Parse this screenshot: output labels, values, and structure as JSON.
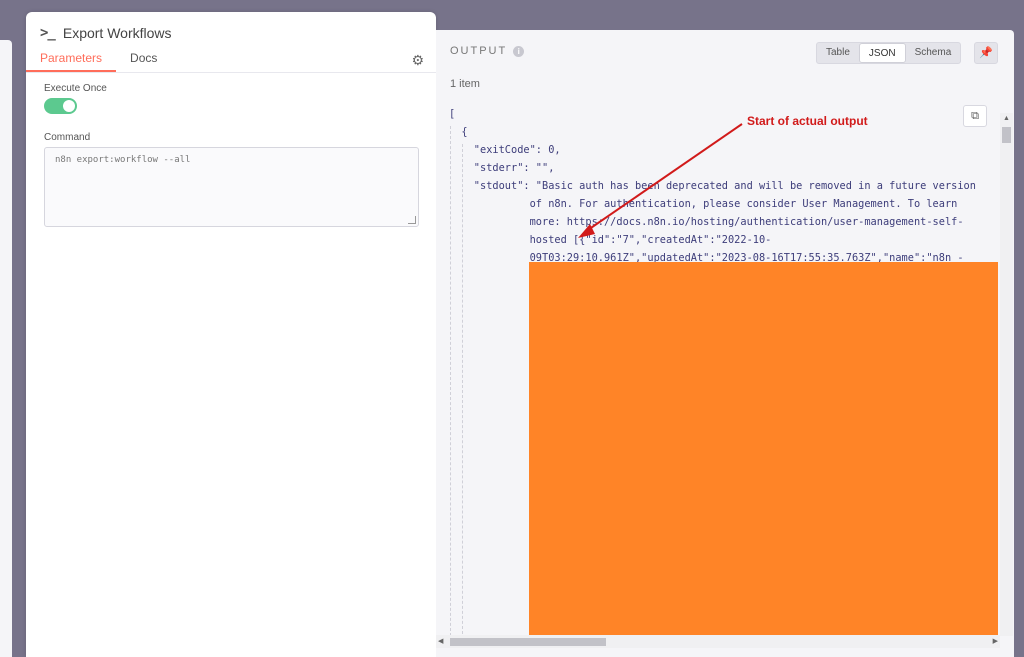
{
  "node": {
    "icon": ">_",
    "title": "Export Workflows",
    "tabs": [
      "Parameters",
      "Docs"
    ],
    "active_tab": "Parameters"
  },
  "params": {
    "execute_once_label": "Execute Once",
    "execute_once_value": true,
    "command_label": "Command",
    "command_value": "n8n export:workflow --all"
  },
  "output": {
    "title": "OUTPUT",
    "item_count": "1 item",
    "views": [
      "Table",
      "JSON",
      "Schema"
    ],
    "active_view": "JSON",
    "json_lines": [
      "[",
      "  {",
      "    \"exitCode\": 0,",
      "    \"stderr\": \"\",",
      "    \"stdout\": \"Basic auth has been deprecated and will be removed in a future version",
      "             of n8n. For authentication, please consider User Management. To learn",
      "             more: https://docs.n8n.io/hosting/authentication/user-management-self-",
      "             hosted [{\"id\":\"7\",\"createdAt\":\"2022-10-",
      "             09T03:29:10.961Z\",\"updatedAt\":\"2023-08-16T17:55:35.763Z\",\"name\":\"n8n -"
    ]
  },
  "annotation": {
    "text": "Start of actual output",
    "color": "#d11a1a"
  },
  "colors": {
    "accent": "#ff6d5a",
    "toggle_on": "#5cc98f",
    "redaction": "#ff8427"
  }
}
